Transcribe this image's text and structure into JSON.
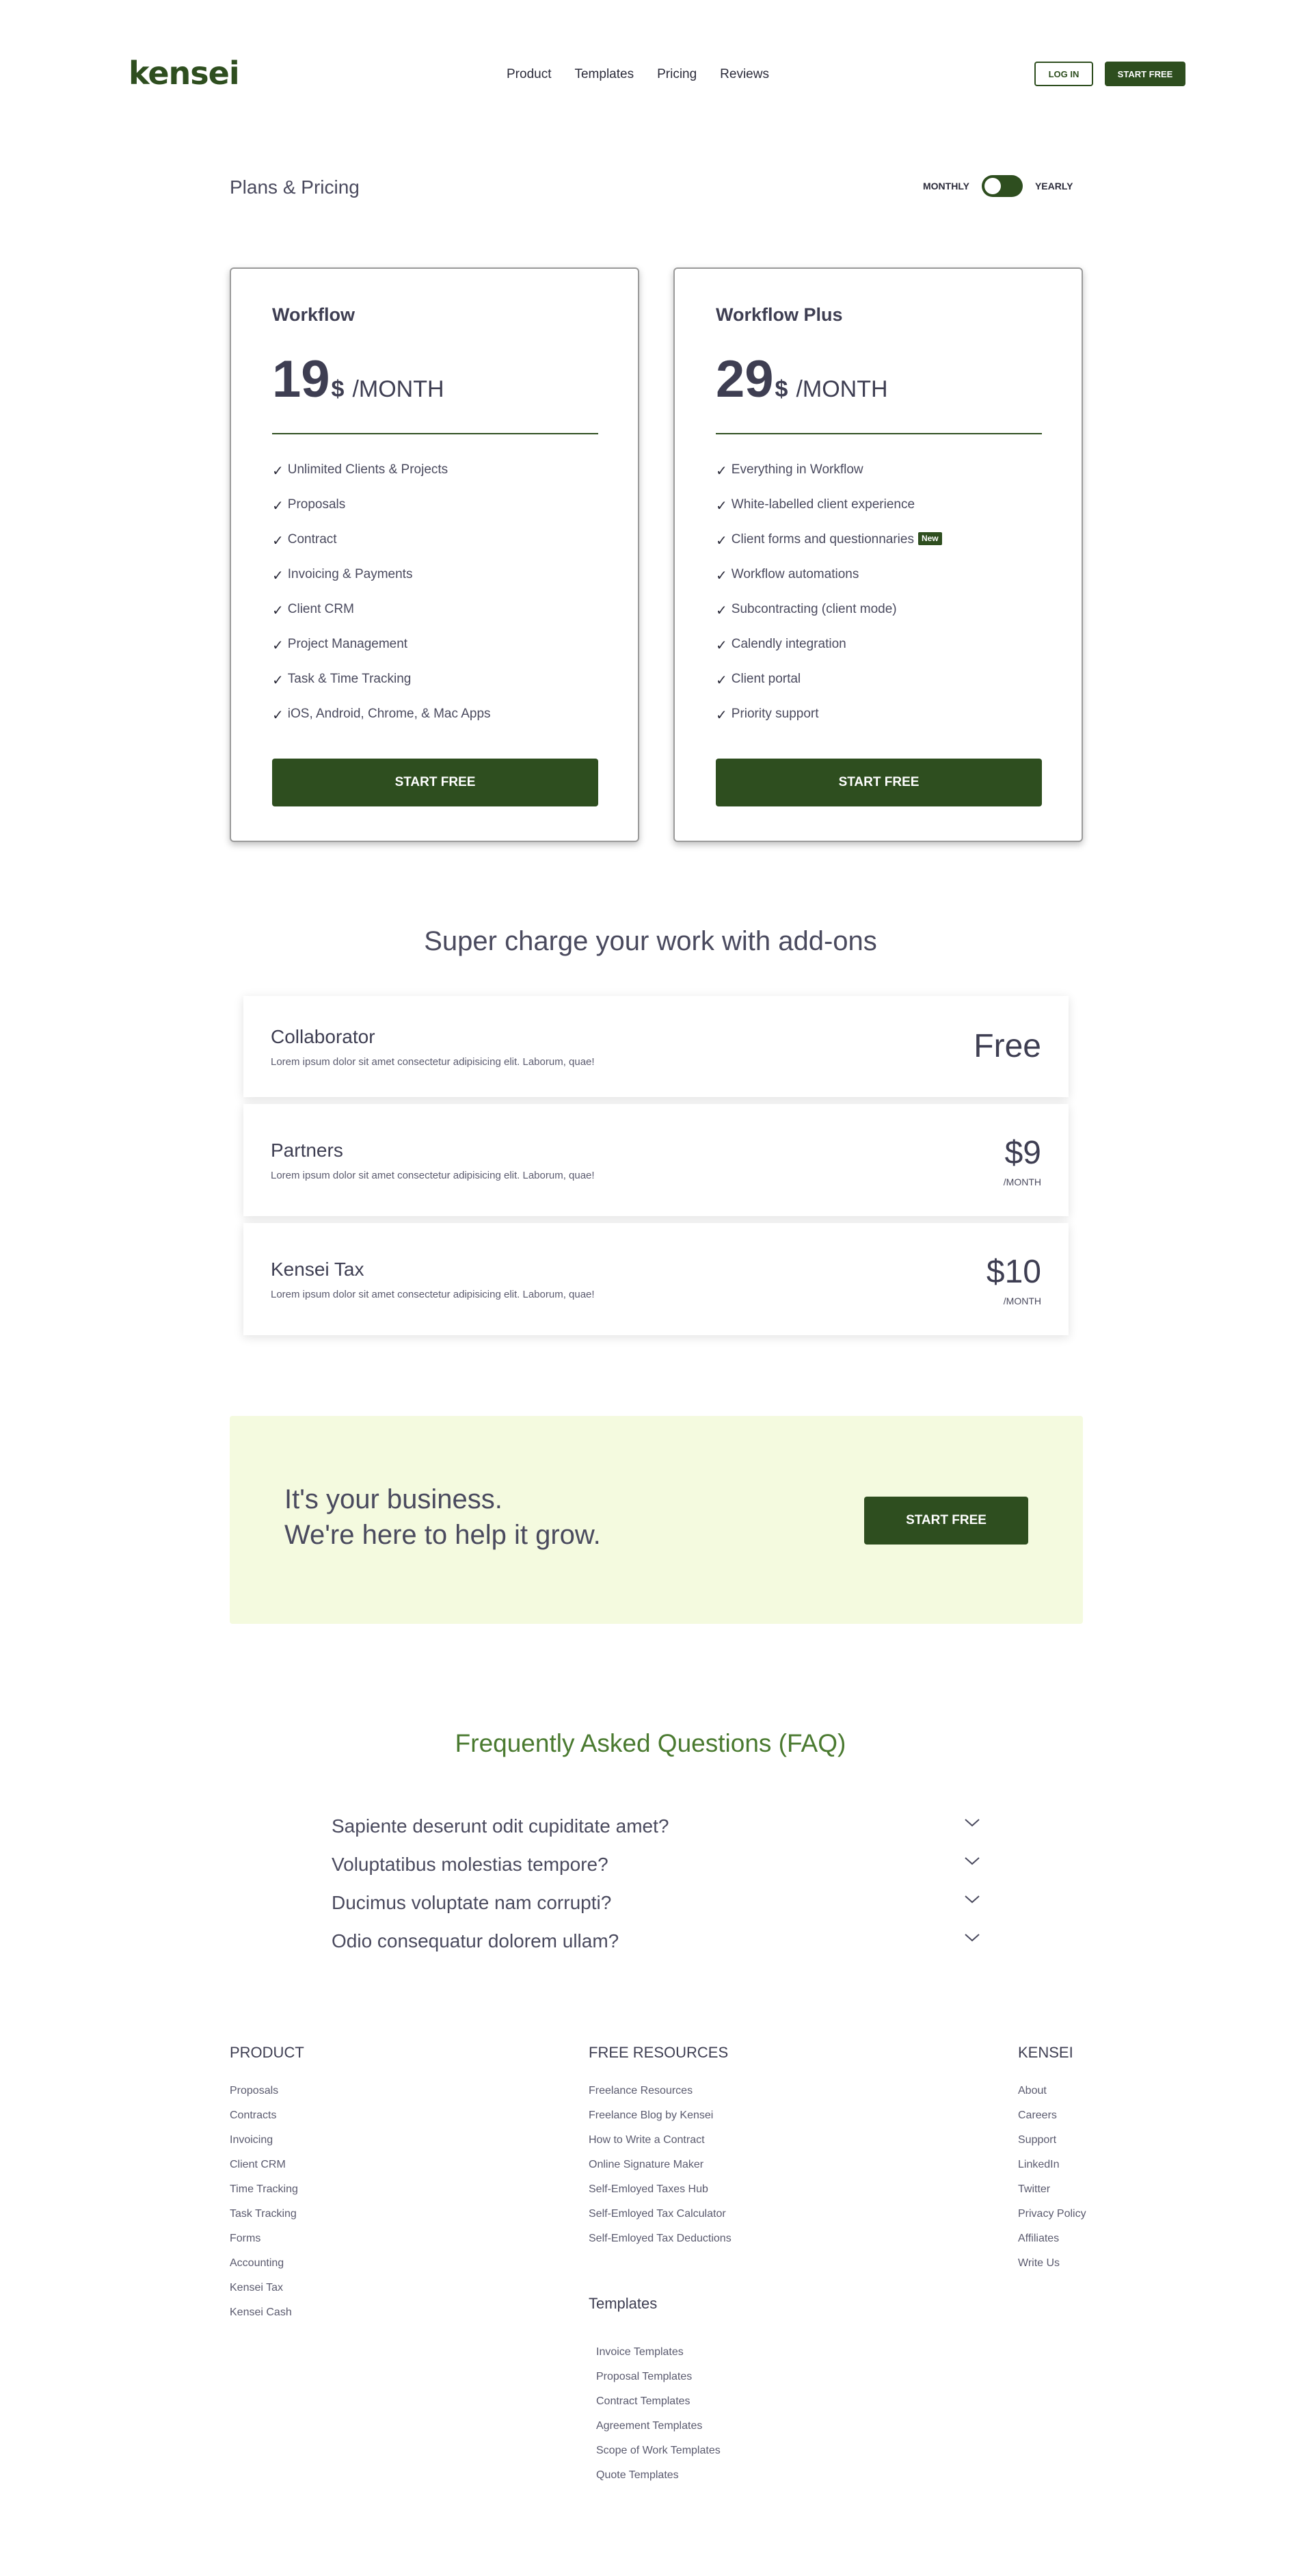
{
  "header": {
    "logo": "kensei",
    "nav": [
      "Product",
      "Templates",
      "Pricing",
      "Reviews"
    ],
    "login_label": "LOG IN",
    "start_label": "START FREE"
  },
  "plans_section": {
    "title": "Plans & Pricing",
    "toggle_monthly": "MONTHLY",
    "toggle_yearly": "YEARLY",
    "plans": [
      {
        "name": "Workflow",
        "price": "19",
        "currency": "$",
        "period": "/MONTH",
        "check_icon": "✓",
        "features": [
          "Unlimited Clients & Projects",
          "Proposals",
          "Contract",
          "Invoicing & Payments",
          "Client CRM",
          "Project Management",
          "Task & Time Tracking",
          "iOS, Android, Chrome, & Mac Apps"
        ],
        "button": "START FREE"
      },
      {
        "name": "Workflow Plus",
        "price": "29",
        "currency": "$",
        "period": "/MONTH",
        "check_icon": "✓",
        "features": [
          "Everything in Workflow",
          "White-labelled client experience",
          "Client forms and questionnaries",
          "Workflow automations",
          "Subcontracting (client mode)",
          "Calendly integration",
          "Client portal",
          "Priority support"
        ],
        "new_badge": "New",
        "button": "START FREE"
      }
    ]
  },
  "addons": {
    "title": "Super charge your work with add-ons",
    "items": [
      {
        "name": "Collaborator",
        "desc": "Lorem ipsum dolor sit amet consectetur adipisicing elit. Laborum, quae!",
        "price": "Free",
        "period": ""
      },
      {
        "name": "Partners",
        "desc": "Lorem ipsum dolor sit amet consectetur adipisicing elit. Laborum, quae!",
        "price": "$9",
        "period": "/MONTH"
      },
      {
        "name": "Kensei Tax",
        "desc": "Lorem ipsum dolor sit amet consectetur adipisicing elit. Laborum, quae!",
        "price": "$10",
        "period": "/MONTH"
      }
    ]
  },
  "cta": {
    "line1": "It's your business.",
    "line2": "We're here to help it grow.",
    "button": "START FREE"
  },
  "faq": {
    "title": "Frequently Asked Questions (FAQ)",
    "questions": [
      "Sapiente deserunt odit cupiditate amet?",
      "Voluptatibus molestias tempore?",
      "Ducimus voluptate nam corrupti?",
      "Odio consequatur dolorem ullam?"
    ]
  },
  "footer": {
    "product": {
      "heading": "PRODUCT",
      "links": [
        "Proposals",
        "Contracts",
        "Invoicing",
        "Client CRM",
        "Time Tracking",
        "Task Tracking",
        "Forms",
        "Accounting",
        "Kensei Tax",
        "Kensei Cash"
      ]
    },
    "resources": {
      "heading": "FREE RESOURCES",
      "links": [
        "Freelance Resources",
        "Freelance Blog by Kensei",
        "How to Write a Contract",
        "Online Signature Maker",
        "Self-Emloyed Taxes Hub",
        "Self-Emloyed Tax Calculator",
        "Self-Emloyed Tax Deductions"
      ]
    },
    "templates": {
      "heading": "Templates",
      "links": [
        "Invoice Templates",
        "Proposal Templates",
        "Contract Templates",
        "Agreement Templates",
        "Scope of Work Templates",
        "Quote Templates"
      ]
    },
    "kensei": {
      "heading": "KENSEI",
      "links": [
        "About",
        "Careers",
        "Support",
        "LinkedIn",
        "Twitter",
        "Privacy Policy",
        "Affiliates",
        "Write Us"
      ]
    }
  },
  "colors": {
    "brand_green": "#2e4e1f",
    "faq_green": "#4a7a30",
    "cta_bg": "#f4fadf",
    "text": "#4a4a5e"
  },
  "icons": {
    "check": "check-icon",
    "chevron": "chevron-down-icon",
    "toggle": "toggle-switch"
  }
}
